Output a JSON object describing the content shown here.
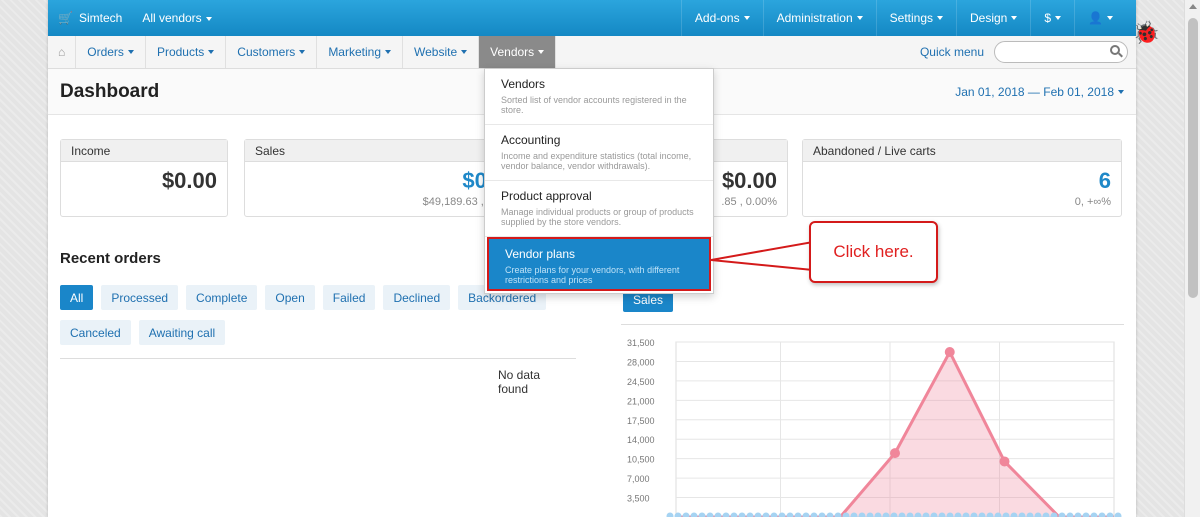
{
  "topbar": {
    "brand": "Simtech",
    "vendor_switch": "All vendors",
    "menus": [
      "Add-ons",
      "Administration",
      "Settings",
      "Design",
      "$",
      ""
    ]
  },
  "navbar": {
    "items": [
      "Orders",
      "Products",
      "Customers",
      "Marketing",
      "Website",
      "Vendors"
    ],
    "active": "Vendors",
    "quick_menu": "Quick menu",
    "search_placeholder": ""
  },
  "page": {
    "title": "Dashboard",
    "date_range": "Jan 01, 2018 — Feb 01, 2018"
  },
  "cards": {
    "income": {
      "title": "Income",
      "value": "$0.00"
    },
    "sales": {
      "title": "Sales",
      "value": "$0.",
      "sub": "$49,189.63 , 0"
    },
    "third": {
      "value": "$0.00",
      "sub": ".85 , 0.00%"
    },
    "carts": {
      "title": "Abandoned / Live carts",
      "value": "6",
      "sub": "0, +∞%"
    }
  },
  "recent_orders": {
    "title": "Recent orders",
    "filters_row1": [
      "All",
      "Processed",
      "Complete",
      "Open",
      "Failed",
      "Declined",
      "Backordered"
    ],
    "filters_row2": [
      "Canceled",
      "Awaiting call"
    ],
    "active_filter": "All",
    "empty_text": "No data found"
  },
  "sales_tab": "Sales",
  "dropdown": {
    "items": [
      {
        "title": "Vendors",
        "desc": "Sorted list of vendor accounts registered in the store."
      },
      {
        "title": "Accounting",
        "desc": "Income and expenditure statistics (total income, vendor balance, vendor withdrawals)."
      },
      {
        "title": "Product approval",
        "desc": "Manage individual products or group of products supplied by the store vendors."
      },
      {
        "title": "Vendor plans",
        "desc": "Create plans for your vendors, with different restrictions and prices"
      }
    ],
    "highlighted": "Vendor plans"
  },
  "callout": "Click here.",
  "colors": {
    "topbar": "#1e9ad6",
    "accent": "#1a86c9",
    "callout": "#d41a1a",
    "chart_line": "#f0869a"
  },
  "chart_data": {
    "type": "area",
    "y_ticks": [
      "31,500",
      "28,000",
      "24,500",
      "21,000",
      "17,500",
      "14,000",
      "10,500",
      "7,000",
      "3,500"
    ],
    "ylim": [
      0,
      31500
    ],
    "x": [
      0,
      1,
      2,
      3,
      4,
      5,
      6,
      7,
      8
    ],
    "values": [
      0,
      0,
      0,
      0,
      11500,
      29700,
      10000,
      0,
      0
    ],
    "grid": true
  }
}
